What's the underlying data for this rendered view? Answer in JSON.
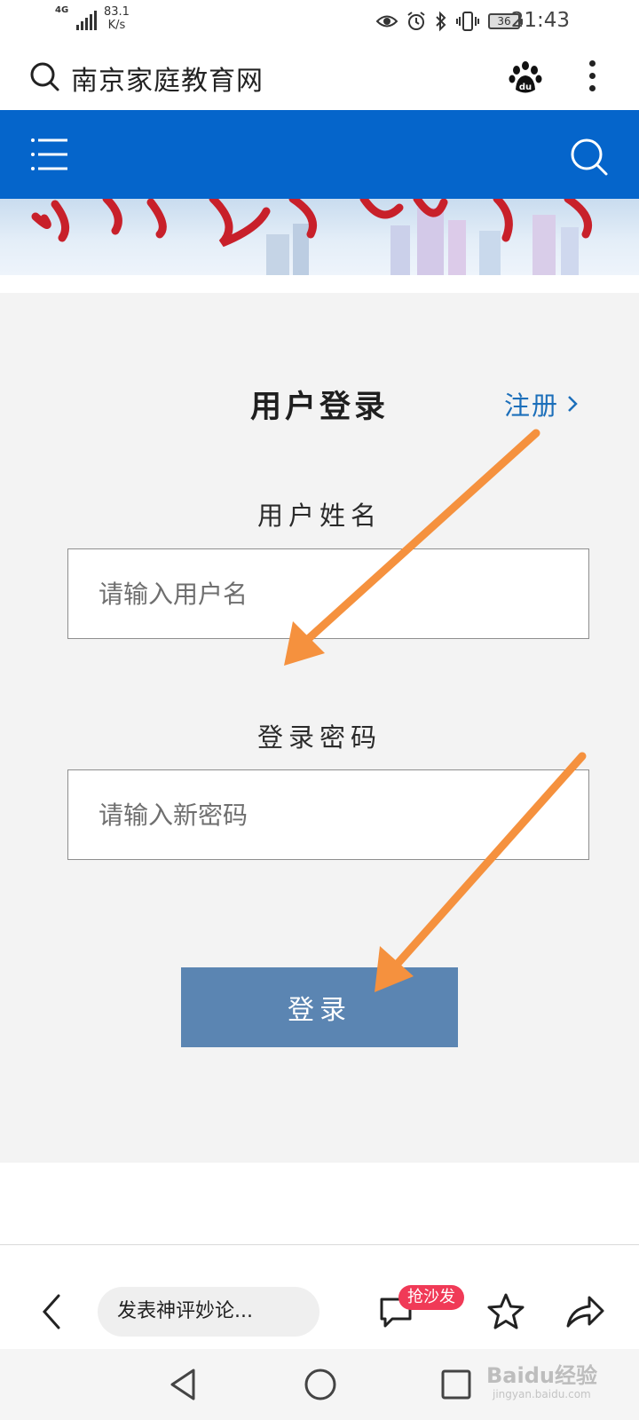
{
  "status_bar": {
    "network": "4G",
    "speed_value": "83.1",
    "speed_unit": "K/s",
    "battery": "36",
    "time": "21:43"
  },
  "browser": {
    "site_title": "南京家庭教育网"
  },
  "login": {
    "title": "用户登录",
    "register_label": "注册",
    "username_label": "用户姓名",
    "username_placeholder": "请输入用户名",
    "password_label": "登录密码",
    "password_placeholder": "请输入新密码",
    "submit_label": "登录"
  },
  "toolbar": {
    "comment_placeholder": "发表神评妙论...",
    "sofa_badge": "抢沙发"
  },
  "watermark": {
    "brand": "Baidu经验",
    "domain": "jingyan.baidu.com"
  },
  "colors": {
    "nav_blue": "#0565cb",
    "button": "#5b85b2",
    "link": "#1c6fba",
    "arrow": "#f5913e",
    "badge": "#f03a57"
  },
  "icons": [
    "search-icon",
    "baidu-paw-icon",
    "more-icon",
    "menu-icon",
    "chevron-right-icon",
    "back-icon",
    "chat-icon",
    "star-icon",
    "share-icon",
    "eye-icon",
    "alarm-icon",
    "bluetooth-icon",
    "vibrate-icon"
  ]
}
